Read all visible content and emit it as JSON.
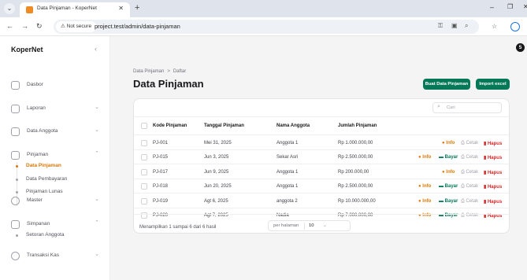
{
  "browser": {
    "tab_title": "Data Pinjaman - KoperNet",
    "security_label": "⚠ Not secure",
    "url": "project.test/admin/data-pinjaman"
  },
  "sidebar": {
    "brand": "KoperNet",
    "groups": [
      {
        "label": "Dasbor",
        "icon": "home-icon"
      },
      {
        "label": "Laporan",
        "icon": "document-icon"
      },
      {
        "label": "Data Anggota",
        "icon": "users-icon"
      },
      {
        "label": "Pinjaman",
        "icon": "box-icon"
      },
      {
        "label": "Master",
        "icon": "gear-icon"
      },
      {
        "label": "Simpanan",
        "icon": "bank-icon"
      },
      {
        "label": "Transaksi Kas",
        "icon": "money-icon"
      }
    ],
    "pinjaman_items": [
      "Data Pinjaman",
      "Data Pembayaran",
      "Pinjaman Lunas"
    ],
    "simpanan_items": [
      "Setoran Anggota"
    ]
  },
  "notification_count": "5",
  "breadcrumb": [
    "Data Pinjaman",
    ">",
    "Daftar"
  ],
  "page_title": "Data Pinjaman",
  "actions": {
    "create": "Buat Data Pinjaman",
    "import": "Import excel"
  },
  "search_placeholder": "Cari",
  "table": {
    "columns": [
      "Kode Pinjaman",
      "Tanggal Pinjaman",
      "Nama Anggota",
      "Jumlah Pinjaman"
    ],
    "rows": [
      {
        "kode": "PJ-001",
        "tanggal": "Mei 31, 2025",
        "nama": "Anggota 1",
        "jumlah": "Rp 1.000.000,00",
        "bayar": false
      },
      {
        "kode": "PJ-015",
        "tanggal": "Jun 3, 2025",
        "nama": "Sekar Asri",
        "jumlah": "Rp 2.500.000,00",
        "bayar": true
      },
      {
        "kode": "PJ-017",
        "tanggal": "Jun 9, 2025",
        "nama": "Anggota 1",
        "jumlah": "Rp 200.000,00",
        "bayar": false
      },
      {
        "kode": "PJ-018",
        "tanggal": "Jun 20, 2025",
        "nama": "Anggota 1",
        "jumlah": "Rp 2.500.000,00",
        "bayar": true
      },
      {
        "kode": "PJ-019",
        "tanggal": "Agt 6, 2025",
        "nama": "anggota 2",
        "jumlah": "Rp 10.000.000,00",
        "bayar": true
      },
      {
        "kode": "PJ-020",
        "tanggal": "Agt 7, 2025",
        "nama": "Nadia",
        "jumlah": "Rp 7.000.000,00",
        "bayar": true
      }
    ],
    "row_actions": {
      "info": "Info",
      "bayar": "Bayar",
      "cetak": "Cetak",
      "hapus": "Hapus"
    }
  },
  "footer": {
    "summary": "Menampilkan 1 sampai 6 dari 6 hasil",
    "per_page_label": "per halaman",
    "per_page_value": "10"
  },
  "colors": {
    "accent": "#d97706",
    "primary_button": "#047857",
    "danger": "#dc2626"
  }
}
